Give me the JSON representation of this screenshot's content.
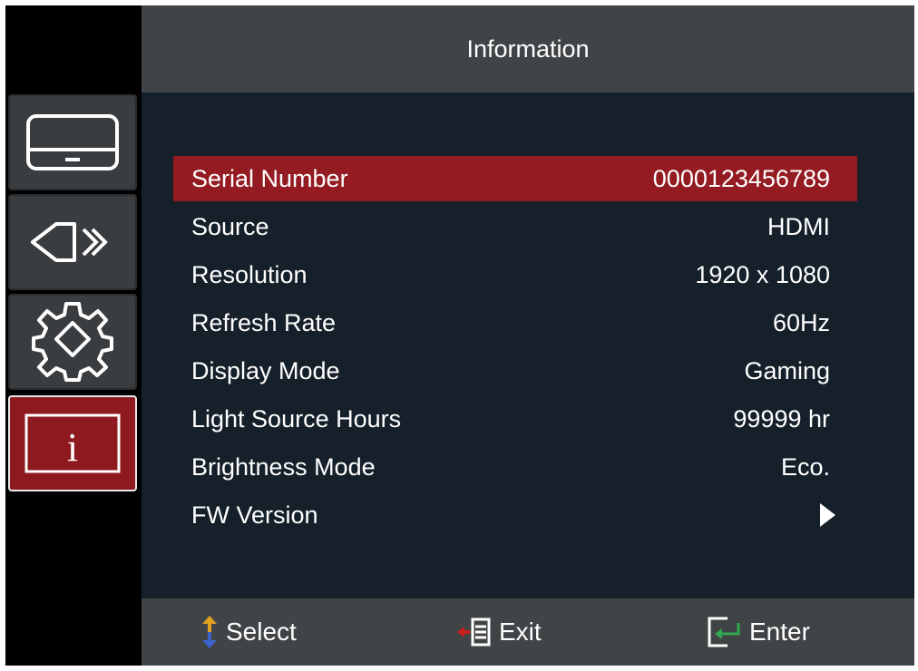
{
  "header": {
    "title": "Information"
  },
  "sidebar": {
    "items": [
      {
        "icon": "display-icon"
      },
      {
        "icon": "audio-icon"
      },
      {
        "icon": "settings-gear-icon"
      },
      {
        "icon": "info-icon",
        "glyph": "i"
      }
    ],
    "active_index": 3
  },
  "info": {
    "rows": [
      {
        "label": "Serial Number",
        "value": "0000123456789"
      },
      {
        "label": "Source",
        "value": "HDMI"
      },
      {
        "label": "Resolution",
        "value": "1920 x 1080"
      },
      {
        "label": "Refresh Rate",
        "value": "60Hz"
      },
      {
        "label": "Display Mode",
        "value": "Gaming"
      },
      {
        "label": "Light Source Hours",
        "value": "99999 hr"
      },
      {
        "label": "Brightness Mode",
        "value": "Eco."
      },
      {
        "label": "FW Version",
        "value": ""
      }
    ],
    "selected_index": 0
  },
  "footer": {
    "select_label": "Select",
    "exit_label": "Exit",
    "enter_label": "Enter"
  },
  "colors": {
    "highlight": "#931b21",
    "panel": "#16202a",
    "bar": "#414446",
    "sidebar_button": "#3a3d40",
    "select_arrow": "#3b63c9",
    "exit_arrow": "#c81e1e",
    "enter_arrow": "#2fa84f"
  }
}
